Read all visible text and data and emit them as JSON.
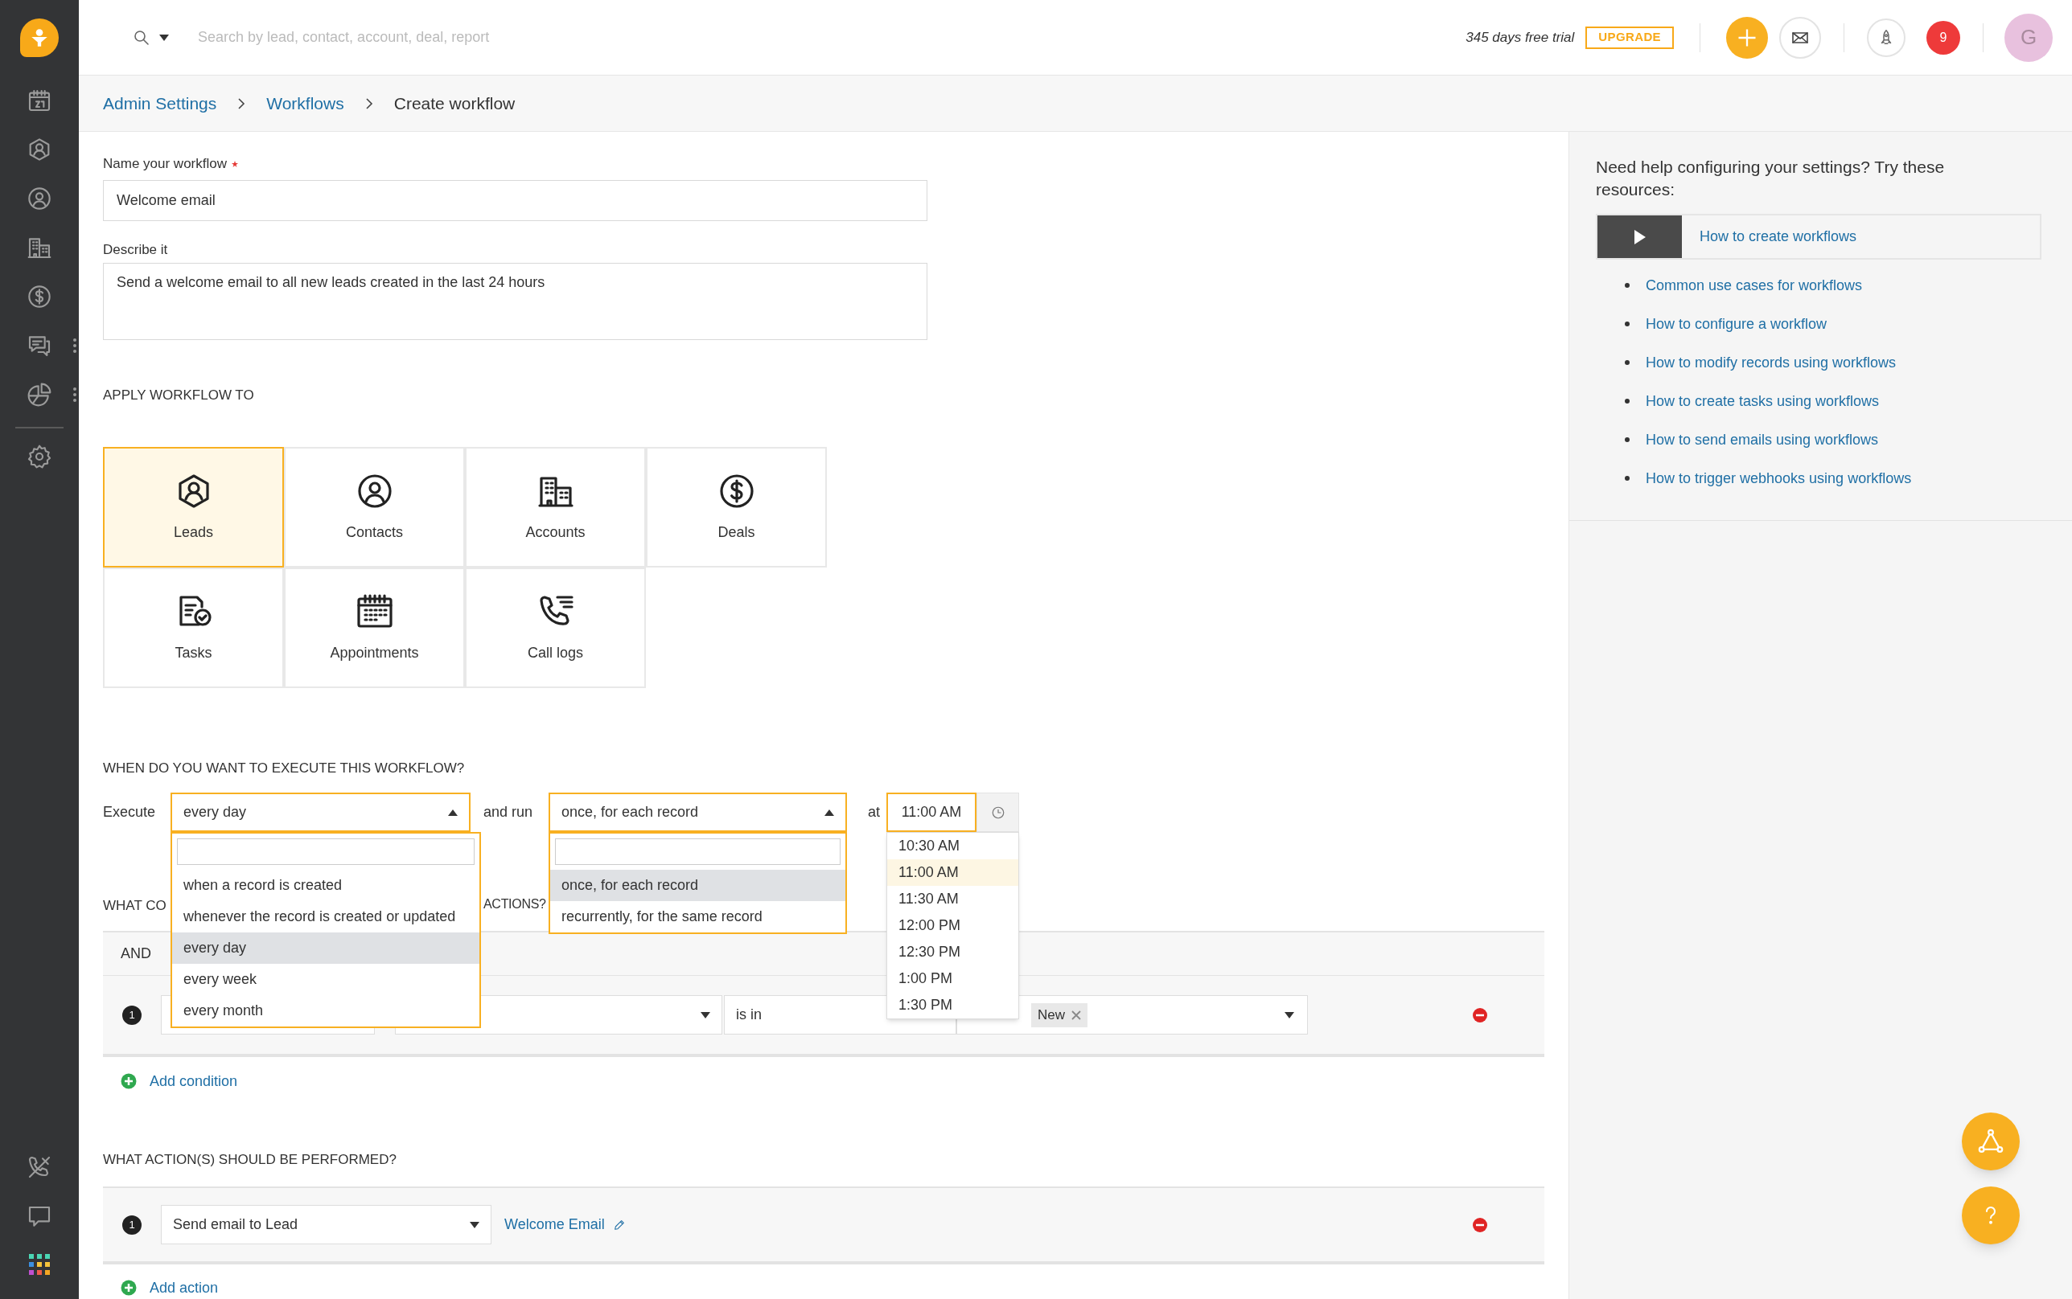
{
  "topbar": {
    "search_placeholder": "Search by lead, contact, account, deal, report",
    "trial": "345 days free trial",
    "upgrade": "UPGRADE",
    "notifications": "9",
    "avatar": "G"
  },
  "breadcrumbs": [
    {
      "label": "Admin Settings",
      "link": true
    },
    {
      "label": "Workflows",
      "link": true
    },
    {
      "label": "Create workflow",
      "link": false
    }
  ],
  "form": {
    "name": {
      "label": "Name your workflow",
      "required": true,
      "value": "Welcome email"
    },
    "description": {
      "label": "Describe it",
      "value": "Send a welcome email to all new leads created in the last 24 hours"
    }
  },
  "apply": {
    "heading": "APPLY WORKFLOW TO",
    "options": [
      {
        "label": "Leads",
        "kind": "leads",
        "selected": true
      },
      {
        "label": "Contacts",
        "kind": "contacts",
        "selected": false
      },
      {
        "label": "Accounts",
        "kind": "accounts",
        "selected": false
      },
      {
        "label": "Deals",
        "kind": "deals",
        "selected": false
      },
      {
        "label": "Tasks",
        "kind": "tasks",
        "selected": false
      },
      {
        "label": "Appointments",
        "kind": "appointments",
        "selected": false
      },
      {
        "label": "Call logs",
        "kind": "calls",
        "selected": false
      }
    ]
  },
  "schedule": {
    "heading": "WHEN DO YOU WANT TO EXECUTE THIS WORKFLOW?",
    "execute": {
      "label": "Execute",
      "value": "every day",
      "expanded": true,
      "options": [
        {
          "label": "when a record is created",
          "selected": false
        },
        {
          "label": "whenever the record is created or updated",
          "selected": false
        },
        {
          "label": "every day",
          "selected": true
        },
        {
          "label": "every week",
          "selected": false
        },
        {
          "label": "every month",
          "selected": false
        }
      ]
    },
    "run": {
      "label": "and run",
      "value": "once, for each record",
      "expanded": true,
      "options": [
        {
          "label": "once, for each record",
          "selected": true
        },
        {
          "label": "recurrently, for the same record",
          "selected": false
        }
      ]
    },
    "time": {
      "label": "at",
      "value": "11:00 AM",
      "expanded": true,
      "options": [
        {
          "label": "10:30 AM",
          "selected": false
        },
        {
          "label": "11:00 AM",
          "selected": true
        },
        {
          "label": "11:30 AM",
          "selected": false
        },
        {
          "label": "12:00 PM",
          "selected": false
        },
        {
          "label": "12:30 PM",
          "selected": false
        },
        {
          "label": "1:00 PM",
          "selected": false
        },
        {
          "label": "1:30 PM",
          "selected": false
        }
      ]
    }
  },
  "conditions": {
    "heading_start": "WHAT CO",
    "heading_end": "ACTIONS?",
    "operator": "AND",
    "rows": [
      {
        "number": "1",
        "operator": "is in",
        "values": [
          "New"
        ]
      }
    ],
    "add": "Add condition"
  },
  "actions": {
    "heading": "WHAT ACTION(S) SHOULD BE PERFORMED?",
    "rows": [
      {
        "number": "1",
        "action": "Send email to Lead",
        "template": "Welcome Email"
      }
    ],
    "add": "Add action"
  },
  "help": {
    "heading": "Need help configuring your settings? Try these resources:",
    "video": "How to create workflows",
    "links": [
      "Common use cases for workflows",
      "How to configure a workflow",
      "How to modify records using workflows",
      "How to create tasks using workflows",
      "How to send emails using workflows",
      "How to trigger webhooks using workflows"
    ]
  }
}
